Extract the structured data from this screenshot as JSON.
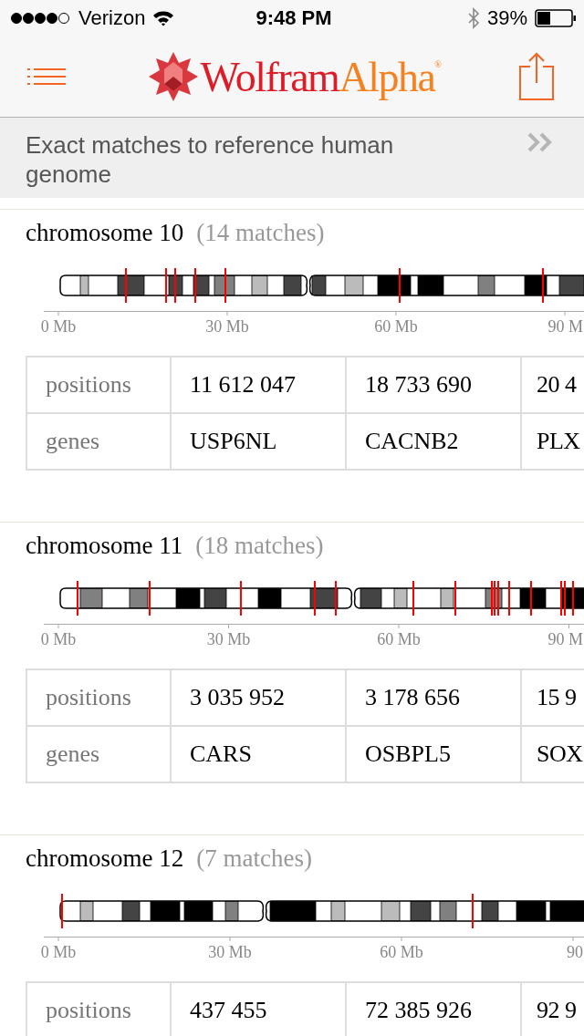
{
  "status_bar": {
    "carrier": "Verizon",
    "time": "9:48 PM",
    "battery": "39%"
  },
  "header": {
    "logo": {
      "name": "Wolfram",
      "suffix": "Alpha",
      "mark": "®"
    }
  },
  "banner": {
    "text": "Exact matches to reference human genome"
  },
  "results": [
    {
      "title": "chromosome 10",
      "count": "(14 matches)",
      "ticks": [
        "0 Mb",
        "30 Mb",
        "60 Mb",
        "90 M"
      ],
      "rows": [
        {
          "label": "positions",
          "cells": [
            "11 612 047",
            "18 733 690",
            "20 4"
          ]
        },
        {
          "label": "genes",
          "cells": [
            "USP6NL",
            "CACNB2",
            "PLX"
          ]
        }
      ]
    },
    {
      "title": "chromosome 11",
      "count": "(18 matches)",
      "ticks": [
        "0 Mb",
        "30 Mb",
        "60 Mb",
        "90 M"
      ],
      "rows": [
        {
          "label": "positions",
          "cells": [
            "3 035 952",
            "3 178 656",
            "15 9"
          ]
        },
        {
          "label": "genes",
          "cells": [
            "CARS",
            "OSBPL5",
            "SOX"
          ]
        }
      ]
    },
    {
      "title": "chromosome 12",
      "count": "(7 matches)",
      "ticks": [
        "0 Mb",
        "30 Mb",
        "60 Mb",
        "90"
      ],
      "rows": [
        {
          "label": "positions",
          "cells": [
            "437 455",
            "72 385 926",
            "92 9"
          ]
        }
      ]
    }
  ]
}
